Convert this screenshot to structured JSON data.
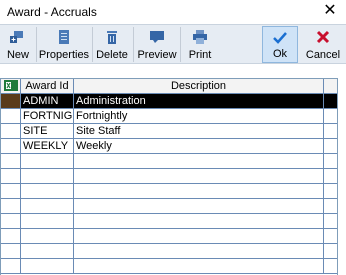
{
  "window": {
    "title": "Award - Accruals"
  },
  "toolbar": {
    "new_label": "New",
    "properties_label": "Properties",
    "delete_label": "Delete",
    "preview_label": "Preview",
    "print_label": "Print",
    "ok_label": "Ok",
    "cancel_label": "Cancel"
  },
  "grid": {
    "columns": [
      "Award Id",
      "Description"
    ],
    "rows": [
      {
        "id": "ADMIN",
        "description": "Administration",
        "selected": true
      },
      {
        "id": "FORTNIGHTLY",
        "description": "Fortnightly",
        "selected": false
      },
      {
        "id": "SITE",
        "description": "Site Staff",
        "selected": false
      },
      {
        "id": "WEEKLY",
        "description": "Weekly",
        "selected": false
      }
    ]
  },
  "colors": {
    "accent": "#1a6fd1",
    "cancel": "#c8102e",
    "grid_line": "#6a8bb5"
  }
}
